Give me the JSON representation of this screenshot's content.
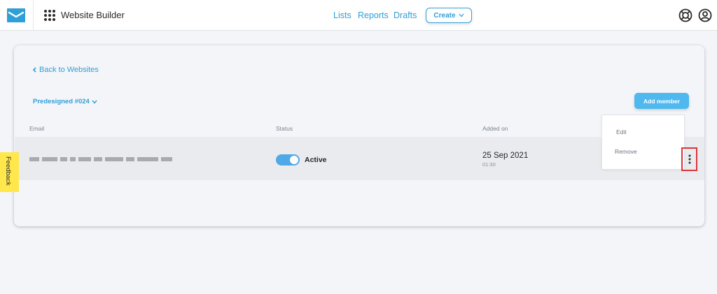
{
  "header": {
    "app_title": "Website Builder",
    "nav": [
      "Lists",
      "Reports",
      "Drafts"
    ],
    "create_label": "Create"
  },
  "page": {
    "back_label": "Back to Websites",
    "website_name": "Predesigned #024",
    "add_member_label": "Add member"
  },
  "table": {
    "columns": [
      "Email",
      "Status",
      "Added on"
    ],
    "rows": [
      {
        "email": "[redacted]",
        "status": "Active",
        "toggle_on": true,
        "added_date": "25 Sep 2021",
        "added_time": "01:30"
      }
    ]
  },
  "row_menu": {
    "items": [
      "Edit",
      "Remove"
    ]
  },
  "feedback_label": "Feedback",
  "colors": {
    "accent": "#2f9fd8",
    "button": "#4fb8ee",
    "highlight": "#d9353a",
    "feedback_bg": "#ffe74c"
  }
}
